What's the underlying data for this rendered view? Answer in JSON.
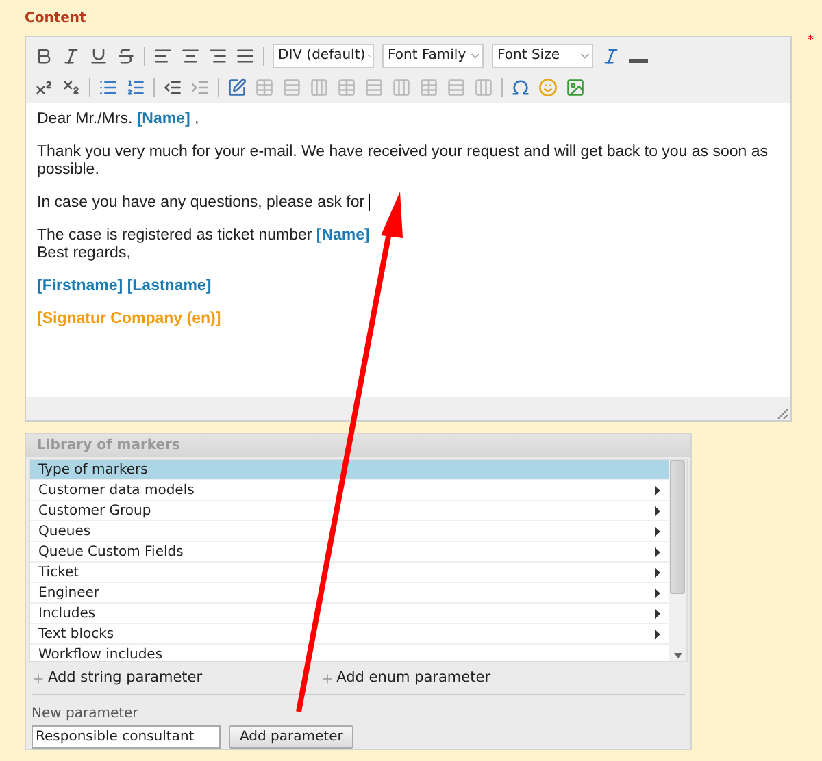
{
  "section_label": "Content",
  "required_mark": "*",
  "toolbar": {
    "dropdowns": [
      "DIV (default)",
      "Font Family",
      "Font Size"
    ]
  },
  "editor": {
    "paragraphs": [
      [
        {
          "kind": "plain",
          "text": "Dear Mr./Mrs. "
        },
        {
          "kind": "marker",
          "text": "[Name]"
        },
        {
          "kind": "plain",
          "text": " ,"
        }
      ],
      [
        {
          "kind": "plain",
          "text": "Thank you very much for your e-mail. We have received your request and will get back to you as soon as possible."
        }
      ],
      [
        {
          "kind": "plain",
          "text": "In case you have any questions, please ask for "
        },
        {
          "kind": "cursor"
        }
      ],
      [
        {
          "kind": "plain",
          "text": "The case is registered as ticket number "
        },
        {
          "kind": "marker",
          "text": "[Name]"
        },
        {
          "kind": "break"
        },
        {
          "kind": "plain",
          "text": "Best regards,"
        }
      ],
      [
        {
          "kind": "marker",
          "text": "[Firstname] [Lastname]"
        }
      ],
      [
        {
          "kind": "signature",
          "text": "[Signatur Company (en)]"
        }
      ]
    ]
  },
  "library": {
    "title": "Library of markers",
    "items": [
      {
        "label": "Type of markers",
        "selected": true,
        "has_submenu": false
      },
      {
        "label": "Customer data models",
        "selected": false,
        "has_submenu": true
      },
      {
        "label": "Customer Group",
        "selected": false,
        "has_submenu": true
      },
      {
        "label": "Queues",
        "selected": false,
        "has_submenu": true
      },
      {
        "label": "Queue Custom Fields",
        "selected": false,
        "has_submenu": true
      },
      {
        "label": "Ticket",
        "selected": false,
        "has_submenu": true
      },
      {
        "label": "Engineer",
        "selected": false,
        "has_submenu": true
      },
      {
        "label": "Includes",
        "selected": false,
        "has_submenu": true
      },
      {
        "label": "Text blocks",
        "selected": false,
        "has_submenu": true
      },
      {
        "label": "Workflow includes",
        "selected": false,
        "has_submenu": false
      }
    ],
    "add_links": [
      "Add string parameter",
      "Add enum parameter"
    ],
    "new_parameter_label": "New parameter",
    "new_parameter_value": "Responsible consultant",
    "add_button": "Add parameter"
  }
}
